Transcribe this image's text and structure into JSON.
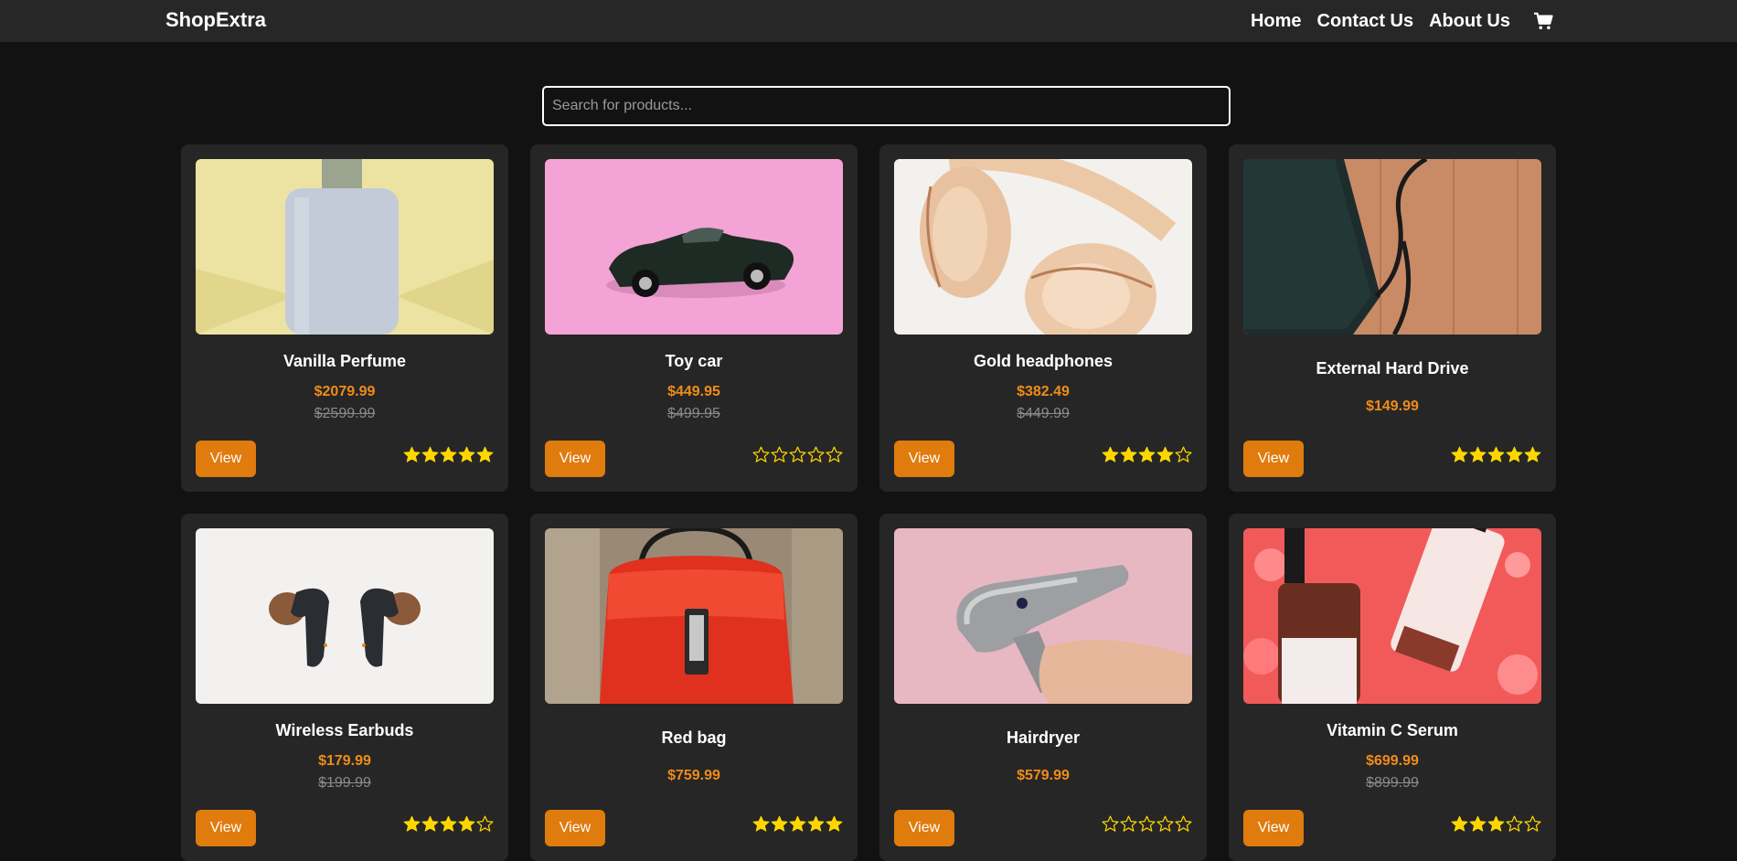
{
  "app": {
    "brand": "ShopExtra"
  },
  "nav": {
    "links": [
      "Home",
      "Contact Us",
      "About Us"
    ],
    "cart_icon": "cart-icon"
  },
  "search": {
    "placeholder": "Search for products...",
    "value": ""
  },
  "colors": {
    "background": "#121212",
    "navbar": "#272727",
    "card": "#262626",
    "accent": "#e07b0e",
    "price": "#f08c1a",
    "old_price": "#8a8a8a",
    "star": "#ffd700"
  },
  "products": [
    {
      "name": "Vanilla Perfume",
      "price": "$2079.99",
      "old_price": "$2599.99",
      "rating": 5,
      "button": "View",
      "image": "perfume-bottle"
    },
    {
      "name": "Toy car",
      "price": "$449.95",
      "old_price": "$499.95",
      "rating": 0,
      "button": "View",
      "image": "toy-car"
    },
    {
      "name": "Gold headphones",
      "price": "$382.49",
      "old_price": "$449.99",
      "rating": 4,
      "button": "View",
      "image": "headphones"
    },
    {
      "name": "External Hard Drive",
      "price": "$149.99",
      "old_price": "",
      "rating": 5,
      "button": "View",
      "image": "hard-drive"
    },
    {
      "name": "Wireless Earbuds",
      "price": "$179.99",
      "old_price": "$199.99",
      "rating": 4,
      "button": "View",
      "image": "earbuds"
    },
    {
      "name": "Red bag",
      "price": "$759.99",
      "old_price": "",
      "rating": 5,
      "button": "View",
      "image": "red-bag"
    },
    {
      "name": "Hairdryer",
      "price": "$579.99",
      "old_price": "",
      "rating": 0,
      "button": "View",
      "image": "hairdryer"
    },
    {
      "name": "Vitamin C Serum",
      "price": "$699.99",
      "old_price": "$899.99",
      "rating": 3,
      "button": "View",
      "image": "serum-bottles"
    }
  ]
}
